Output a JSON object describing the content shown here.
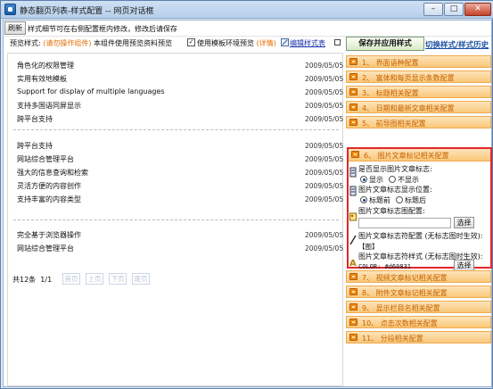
{
  "window": {
    "title": "静态翻页列表-样式配置 -- 网页对话框",
    "minimize": "0",
    "maximize": "1",
    "close": "r"
  },
  "hint": {
    "refresh_label": "刷新",
    "text": "样式细节可在右侧配置框内修改，修改后请保存"
  },
  "toolbar": {
    "preview_prefix": "预览样式:",
    "preview_name": "(请勿操作组件)",
    "preview_suffix": "本组件使用预览资料预览",
    "template_check_label": "使用模板环境预览",
    "details_link": "(详情)",
    "edit_style_link": "编辑样式表",
    "check_mark": "✓"
  },
  "list": {
    "group1": [
      {
        "title": "角色化的权限管理",
        "date": "2009/05/05"
      },
      {
        "title": "实用有效地模板",
        "date": "2009/05/05"
      },
      {
        "title": "Support for display of multiple languages",
        "date": "2009/05/05"
      },
      {
        "title": "支持多国语同屏显示",
        "date": "2009/05/05"
      },
      {
        "title": "跨平台支持",
        "date": "2009/05/05"
      }
    ],
    "group2": [
      {
        "title": "跨平台支持",
        "date": "2009/05/05"
      },
      {
        "title": "网站综合管理平台",
        "date": "2009/05/05"
      },
      {
        "title": "强大的信息查询和检索",
        "date": "2009/05/05"
      },
      {
        "title": "灵活方便的内容创作",
        "date": "2009/05/05"
      },
      {
        "title": "支持丰富的内容类型",
        "date": "2009/05/05"
      }
    ],
    "group3": [
      {
        "title": "完全基于浏览器操作",
        "date": "2009/05/05"
      },
      {
        "title": "网站综合管理平台",
        "date": "2009/05/05"
      }
    ]
  },
  "pager": {
    "total": "共12条",
    "page": "1/1",
    "first": "首页",
    "prev": "上页",
    "next": "下页",
    "last": "尾页"
  },
  "right": {
    "save_button": "保存并应用样式",
    "history_link": "切换样式/样式历史"
  },
  "accordion": {
    "sections_top": [
      "1、 界面语种配置",
      "2、 富体和每页显示条数配置",
      "3、 标题相关配置",
      "4、 日期和最新文章相关配置",
      "5、 前导图相关配置"
    ],
    "open_section": "6、 图片文章标记相关配置",
    "sections_bottom": [
      "7、 视频文章标记相关配置",
      "8、 附件文章标记相关配置",
      "9、 显示栏目名相关配置",
      "10、 点击次数相关配置",
      "11、 分段相关配置"
    ]
  },
  "open_form": {
    "show_label": "是否显示图片文章标志:",
    "show_yes": "显示",
    "show_no": "不显示",
    "pos_label": "图片文章标志显示位置:",
    "pos_before": "标题前",
    "pos_after": "标题后",
    "image_label": "图片文章标志图配置:",
    "pick_button": "选择",
    "symbol_label": "图片文章标志符配置 (无标志图时生效):",
    "symbol_value": "【图】",
    "style_label": "图片文章标志符样式 (无标志图时生效):",
    "style_value": "COLOR: #d60831",
    "pick_button_2": "选择"
  },
  "colors": {
    "accent_red": "#e1282b",
    "accordion_orange": "#f9c87a",
    "link_blue": "#1b4fa3"
  }
}
